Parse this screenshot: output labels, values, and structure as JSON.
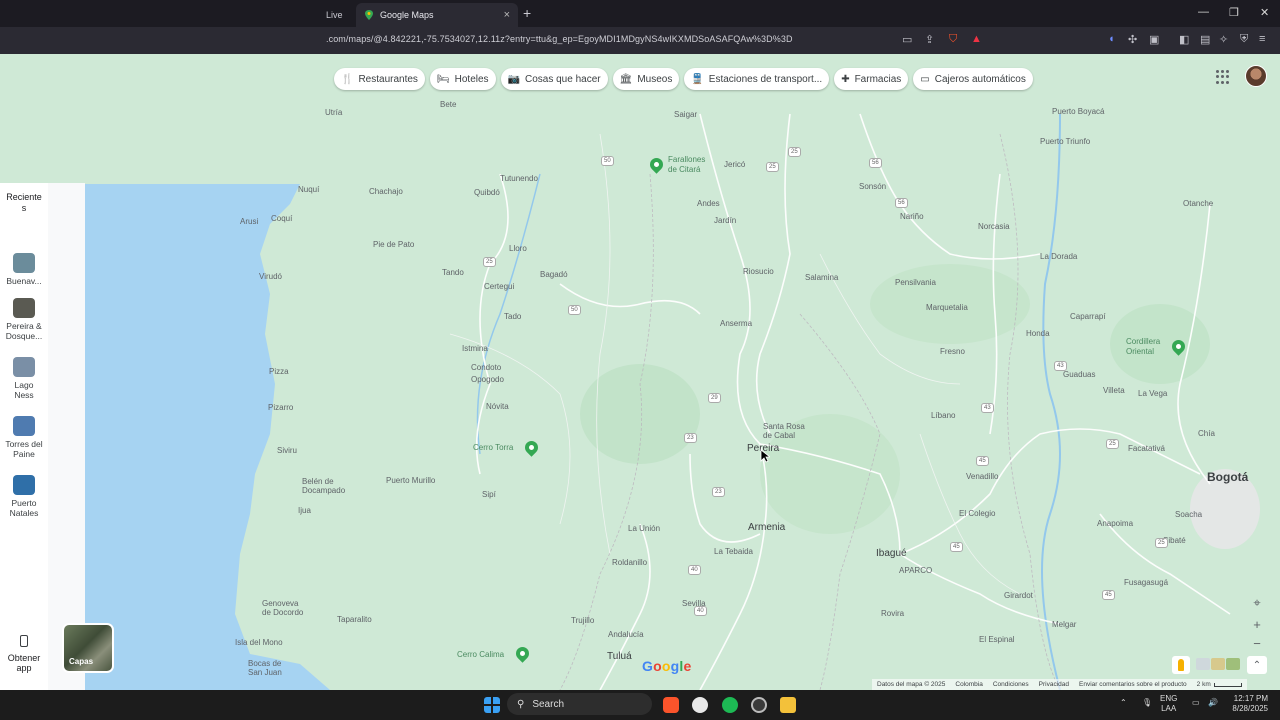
{
  "browser": {
    "tab_live": "Live",
    "tab_title": "Google Maps",
    "tab_close": "×",
    "new_tab": "+",
    "url": ".com/maps/@4.842221,-75.7534027,12.11z?entry=ttu&g_ep=EgoyMDI1MDgyNS4wIKXMDSoASAFQAw%3D%3D",
    "window_controls": [
      "—",
      "❐",
      "✕"
    ]
  },
  "chips": [
    {
      "label": "Restaurantes",
      "icon": "fork-knife-icon",
      "glyph": "🍴"
    },
    {
      "label": "Hoteles",
      "icon": "bed-icon",
      "glyph": "🛏"
    },
    {
      "label": "Cosas que hacer",
      "icon": "camera-icon",
      "glyph": "📷"
    },
    {
      "label": "Museos",
      "icon": "museum-icon",
      "glyph": "🏛"
    },
    {
      "label": "Estaciones de transport...",
      "icon": "train-icon",
      "glyph": "🚆"
    },
    {
      "label": "Farmacias",
      "icon": "pharmacy-icon",
      "glyph": "✚"
    },
    {
      "label": "Cajeros automáticos",
      "icon": "atm-icon",
      "glyph": "▭"
    }
  ],
  "sidebar": {
    "recent_label": "Reciente\ns",
    "places": [
      {
        "label": "Buenav...",
        "color": "#6b8c9b"
      },
      {
        "label": "Pereira &\nDosque...",
        "color": "#5a5a52"
      },
      {
        "label": "Lago\nNess",
        "color": "#7a8fa6"
      },
      {
        "label": "Torres del\nPaine",
        "color": "#4f7bb0"
      },
      {
        "label": "Puerto\nNatales",
        "color": "#2f6fa8"
      }
    ],
    "get_app": "Obtener\napp"
  },
  "map": {
    "cities": [
      {
        "name": "Pereira",
        "size": "big"
      },
      {
        "name": "Armenia",
        "size": "big"
      },
      {
        "name": "Ibagué",
        "size": "big"
      },
      {
        "name": "Bogotá",
        "size": "cap"
      },
      {
        "name": "Tuluá",
        "size": "big"
      }
    ],
    "towns": [
      "Bete",
      "Saigar",
      "Quibdó",
      "Tutunendo",
      "Chachajo",
      "Pie de Pato",
      "Lloro",
      "Tando",
      "Bagadó",
      "Certegui",
      "Tado",
      "Istmina",
      "Condoto",
      "Opogodo",
      "Nóvita",
      "Sipí",
      "Puerto Murillo",
      "Belén de\nDocampado",
      "Ijua",
      "Arusi",
      "Coquí",
      "Virudó",
      "Pizza",
      "Pizarro",
      "Siviru",
      "Genoveva\nde Docordo",
      "Isla del Mono",
      "Bocas de\nSan Juan",
      "Taparalito",
      "Jericó",
      "Andes",
      "Jardín",
      "Riosucio",
      "Salamina",
      "Anserma",
      "Santa Rosa\nde Cabal",
      "La Unión",
      "Roldanillo",
      "La Tebaida",
      "Trujillo",
      "Sevilla",
      "Andalucía",
      "Sonsón",
      "Nariño",
      "Norcasia",
      "Pensilvania",
      "Marquetalia",
      "Fresno",
      "Líbano",
      "Venadillo",
      "El Colegio",
      "APARCO",
      "Girardot",
      "Rovira",
      "El Espinal",
      "Melgar",
      "Puerto Boyacá",
      "Puerto Triunfo",
      "Otanche",
      "La Dorada",
      "Caparrapí",
      "Honda",
      "Guaduas",
      "Villeta",
      "La Vega",
      "Facatativá",
      "Anapoima",
      "Soacha",
      "Sibaté",
      "Fusagasugá",
      "Chía",
      "Nuquí",
      "Utría"
    ],
    "parks": [
      "Farallones\nde Citará",
      "Cerro Torra",
      "Cerro Calima",
      "Cordillera\nOriental"
    ],
    "road_numbers": [
      "50",
      "25",
      "56",
      "56",
      "25",
      "50",
      "23",
      "29",
      "25",
      "45",
      "45",
      "25",
      "25",
      "43",
      "40",
      "40",
      "23",
      "43",
      "45"
    ]
  },
  "map_footer": [
    "Datos del mapa © 2025",
    "Colombia",
    "Condiciones",
    "Privacidad",
    "Enviar comentarios sobre el producto",
    "2 km"
  ],
  "capas_label": "Capas",
  "google_logo": "Google",
  "taskbar": {
    "search_label": "Search",
    "lang": "ENG\nLAA",
    "time": "12:17 PM",
    "date": "8/28/2025"
  }
}
